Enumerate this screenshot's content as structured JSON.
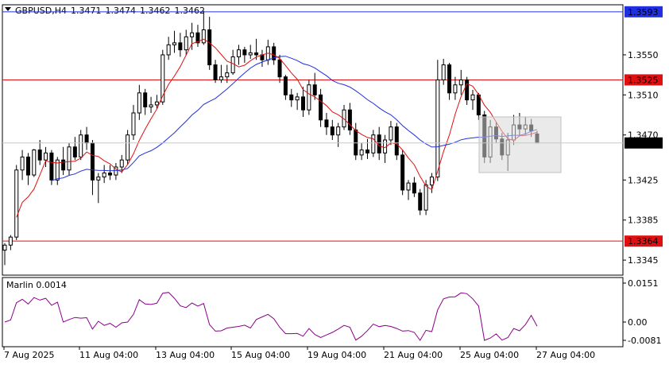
{
  "header": {
    "symbol": "GBPUSD,H4",
    "open": "1.3471",
    "high": "1.3474",
    "low": "1.3462",
    "close": "1.3462"
  },
  "price_axis": {
    "ticks": [
      "1.3550",
      "1.3510",
      "1.3470",
      "1.3425",
      "1.3385",
      "1.3345"
    ],
    "levels": [
      {
        "value": "1.3593",
        "color": "#2030e0"
      },
      {
        "value": "1.3525",
        "color": "#e01010"
      },
      {
        "value": "1.3364",
        "color": "#e01010"
      }
    ],
    "current": "1.3462"
  },
  "indicator": {
    "label": "Marlin 0.0014",
    "ticks": [
      "0.0151",
      "0.00",
      "-0.0081"
    ],
    "color": "#8b008b"
  },
  "time_axis": [
    "7 Aug 2025",
    "11 Aug 04:00",
    "13 Aug 04:00",
    "15 Aug 04:00",
    "19 Aug 04:00",
    "21 Aug 04:00",
    "25 Aug 04:00",
    "27 Aug 04:00"
  ],
  "colors": {
    "candle": "#000000",
    "ma_fast": "#e01010",
    "ma_slow": "#2030e0",
    "background": "#ffffff",
    "rect": "#d8d8d8"
  },
  "chart_data": {
    "type": "candlestick",
    "symbol": "GBPUSD",
    "timeframe": "H4",
    "ylim": [
      1.333,
      1.36
    ],
    "candles": [
      [
        1.3355,
        1.3362,
        1.334,
        1.336
      ],
      [
        1.336,
        1.337,
        1.3355,
        1.3368
      ],
      [
        1.3368,
        1.344,
        1.3365,
        1.3435
      ],
      [
        1.3435,
        1.3455,
        1.3425,
        1.3448
      ],
      [
        1.3448,
        1.3452,
        1.342,
        1.343
      ],
      [
        1.343,
        1.3456,
        1.3428,
        1.3455
      ],
      [
        1.3455,
        1.3465,
        1.344,
        1.3445
      ],
      [
        1.3445,
        1.3458,
        1.3438,
        1.3452
      ],
      [
        1.3452,
        1.3455,
        1.342,
        1.3425
      ],
      [
        1.3425,
        1.3448,
        1.342,
        1.3445
      ],
      [
        1.3445,
        1.3458,
        1.343,
        1.3435
      ],
      [
        1.3435,
        1.3462,
        1.343,
        1.3458
      ],
      [
        1.3458,
        1.3468,
        1.3445,
        1.3448
      ],
      [
        1.3448,
        1.3475,
        1.3445,
        1.347
      ],
      [
        1.347,
        1.3478,
        1.3455,
        1.3462
      ],
      [
        1.3462,
        1.3465,
        1.341,
        1.3425
      ],
      [
        1.3425,
        1.3432,
        1.3402,
        1.3428
      ],
      [
        1.3428,
        1.344,
        1.3422,
        1.3432
      ],
      [
        1.3432,
        1.344,
        1.3425,
        1.343
      ],
      [
        1.343,
        1.3442,
        1.3425,
        1.3438
      ],
      [
        1.3438,
        1.345,
        1.3432,
        1.3445
      ],
      [
        1.3445,
        1.3475,
        1.344,
        1.347
      ],
      [
        1.347,
        1.35,
        1.3465,
        1.3492
      ],
      [
        1.3492,
        1.352,
        1.3485,
        1.3512
      ],
      [
        1.3512,
        1.3516,
        1.349,
        1.3498
      ],
      [
        1.3498,
        1.3508,
        1.3492,
        1.35
      ],
      [
        1.35,
        1.351,
        1.3496,
        1.3503
      ],
      [
        1.3503,
        1.3555,
        1.35,
        1.355
      ],
      [
        1.355,
        1.3568,
        1.3545,
        1.356
      ],
      [
        1.356,
        1.3574,
        1.3552,
        1.3562
      ],
      [
        1.3562,
        1.3572,
        1.3548,
        1.3555
      ],
      [
        1.3555,
        1.3575,
        1.355,
        1.3568
      ],
      [
        1.3568,
        1.3582,
        1.3555,
        1.3572
      ],
      [
        1.3572,
        1.358,
        1.3558,
        1.3562
      ],
      [
        1.3562,
        1.3594,
        1.356,
        1.3575
      ],
      [
        1.3575,
        1.3588,
        1.3535,
        1.354
      ],
      [
        1.354,
        1.3545,
        1.3522,
        1.3525
      ],
      [
        1.3525,
        1.354,
        1.3522,
        1.3528
      ],
      [
        1.3528,
        1.354,
        1.3522,
        1.3532
      ],
      [
        1.3532,
        1.3555,
        1.353,
        1.3548
      ],
      [
        1.3548,
        1.356,
        1.354,
        1.3555
      ],
      [
        1.3555,
        1.3558,
        1.3542,
        1.355
      ],
      [
        1.355,
        1.356,
        1.3546,
        1.3552
      ],
      [
        1.3552,
        1.3566,
        1.3545,
        1.355
      ],
      [
        1.355,
        1.3555,
        1.3538,
        1.3545
      ],
      [
        1.3545,
        1.3565,
        1.354,
        1.3558
      ],
      [
        1.3558,
        1.3562,
        1.354,
        1.3545
      ],
      [
        1.3545,
        1.355,
        1.3522,
        1.3528
      ],
      [
        1.3528,
        1.353,
        1.3505,
        1.351
      ],
      [
        1.351,
        1.3516,
        1.3498,
        1.3505
      ],
      [
        1.3505,
        1.3512,
        1.3495,
        1.3508
      ],
      [
        1.3508,
        1.3518,
        1.3488,
        1.3495
      ],
      [
        1.3495,
        1.3525,
        1.349,
        1.352
      ],
      [
        1.352,
        1.3532,
        1.3505,
        1.351
      ],
      [
        1.351,
        1.3516,
        1.3478,
        1.3485
      ],
      [
        1.3485,
        1.3492,
        1.347,
        1.3478
      ],
      [
        1.3478,
        1.3485,
        1.3465,
        1.347
      ],
      [
        1.347,
        1.3482,
        1.3458,
        1.3478
      ],
      [
        1.3478,
        1.35,
        1.3475,
        1.3495
      ],
      [
        1.3495,
        1.3502,
        1.347,
        1.3475
      ],
      [
        1.3475,
        1.3482,
        1.3445,
        1.345
      ],
      [
        1.345,
        1.3462,
        1.3445,
        1.3455
      ],
      [
        1.3455,
        1.3466,
        1.3446,
        1.3452
      ],
      [
        1.3452,
        1.3475,
        1.3448,
        1.347
      ],
      [
        1.347,
        1.3478,
        1.3445,
        1.3452
      ],
      [
        1.3452,
        1.347,
        1.3442,
        1.3465
      ],
      [
        1.3465,
        1.3484,
        1.346,
        1.3478
      ],
      [
        1.3478,
        1.3482,
        1.3445,
        1.345
      ],
      [
        1.345,
        1.3455,
        1.341,
        1.3415
      ],
      [
        1.3415,
        1.3425,
        1.3405,
        1.3422
      ],
      [
        1.3422,
        1.3428,
        1.3408,
        1.3412
      ],
      [
        1.3412,
        1.3416,
        1.339,
        1.3395
      ],
      [
        1.3395,
        1.3425,
        1.339,
        1.342
      ],
      [
        1.342,
        1.3432,
        1.3412,
        1.3428
      ],
      [
        1.3428,
        1.3545,
        1.3424,
        1.3525
      ],
      [
        1.3525,
        1.3546,
        1.352,
        1.354
      ],
      [
        1.354,
        1.3542,
        1.3505,
        1.3512
      ],
      [
        1.3512,
        1.3528,
        1.3505,
        1.352
      ],
      [
        1.352,
        1.3535,
        1.351,
        1.3525
      ],
      [
        1.3525,
        1.3528,
        1.35,
        1.3505
      ],
      [
        1.3505,
        1.3515,
        1.3495,
        1.351
      ],
      [
        1.351,
        1.3512,
        1.3485,
        1.349
      ],
      [
        1.349,
        1.3494,
        1.3442,
        1.3448
      ],
      [
        1.3448,
        1.3485,
        1.3442,
        1.3478
      ],
      [
        1.3478,
        1.3483,
        1.3462,
        1.3466
      ],
      [
        1.3466,
        1.3472,
        1.3445,
        1.345
      ],
      [
        1.345,
        1.3472,
        1.3434,
        1.3465
      ],
      [
        1.3465,
        1.349,
        1.346,
        1.348
      ],
      [
        1.348,
        1.3492,
        1.347,
        1.3476
      ],
      [
        1.3476,
        1.3488,
        1.347,
        1.348
      ],
      [
        1.348,
        1.3486,
        1.3468,
        1.3474
      ],
      [
        1.3471,
        1.3474,
        1.3462,
        1.3462
      ]
    ]
  }
}
